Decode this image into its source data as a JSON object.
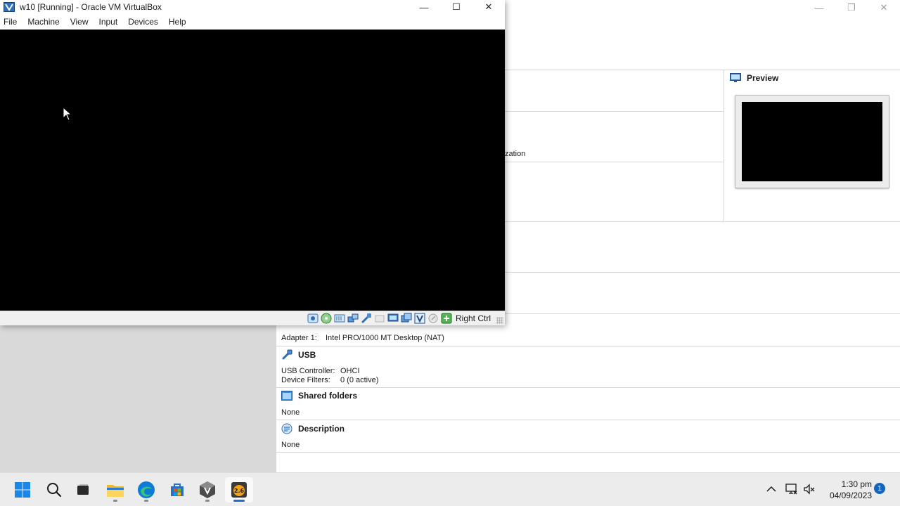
{
  "vm_window": {
    "title": "w10 [Running] - Oracle VM VirtualBox",
    "menu": [
      "File",
      "Machine",
      "View",
      "Input",
      "Devices",
      "Help"
    ],
    "window_controls": {
      "minimize": "—",
      "maximize": "☐",
      "close": "✕"
    },
    "screen_color": "#000000",
    "status_icons": [
      "hard-disk-icon",
      "optical-drive-icon",
      "audio-icon",
      "network-icon",
      "usb-icon",
      "shared-folders-icon",
      "display-icon",
      "video-capture-icon",
      "virtualization-icon",
      "mouse-integration-icon",
      "keyboard-icon"
    ],
    "host_key": "Right Ctrl"
  },
  "manager": {
    "window_controls": {
      "minimize": "—",
      "maximize": "❐",
      "close": "✕"
    },
    "partial_text": "zation",
    "preview": {
      "title": "Preview"
    },
    "network": {
      "adapter_label": "Adapter 1:",
      "adapter_value": "Intel PRO/1000 MT Desktop (NAT)"
    },
    "usb": {
      "title": "USB",
      "controller_label": "USB Controller:",
      "controller_value": "OHCI",
      "filters_label": "Device Filters:",
      "filters_value": "0 (0 active)"
    },
    "shared_folders": {
      "title": "Shared folders",
      "value": "None"
    },
    "description": {
      "title": "Description",
      "value": "None"
    }
  },
  "taskbar": {
    "apps": [
      "start-button",
      "search-button",
      "task-view-button",
      "file-explorer",
      "edge-browser",
      "microsoft-store",
      "virtualbox",
      "gns3"
    ],
    "time": "1:30 pm",
    "date": "04/09/2023",
    "notification_count": "1",
    "gns3_label": "2.6"
  },
  "colors": {
    "accent": "#1a6ed8",
    "vm_screen": "#000000",
    "sidebar": "#d9d9d9"
  }
}
